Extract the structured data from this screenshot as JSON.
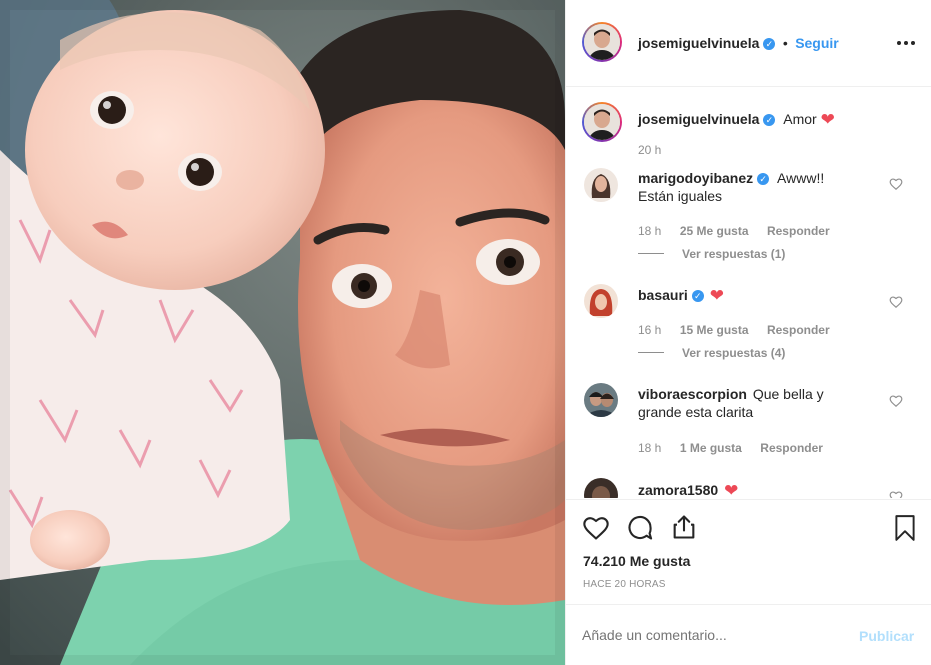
{
  "post": {
    "author": "josemiguelvinuela",
    "separator": "•",
    "follow_label": "Seguir",
    "more_icon": "more-horizontal-icon",
    "caption_text": "Amor",
    "caption_time": "20 h",
    "likes_text": "74.210 Me gusta",
    "posted_ago": "HACE 20 HORAS",
    "comment_placeholder": "Añade un comentario...",
    "publish_label": "Publicar"
  },
  "comments": [
    {
      "user": "marigodoyibanez",
      "verified": true,
      "text_line1": "Awww!!",
      "text_line2": "Están iguales",
      "time": "18 h",
      "likes": "25 Me gusta",
      "reply": "Responder",
      "view_replies": "Ver respuestas (1)"
    },
    {
      "user": "basauri",
      "verified": true,
      "time": "16 h",
      "likes": "15 Me gusta",
      "reply": "Responder",
      "view_replies": "Ver respuestas (4)"
    },
    {
      "user": "viboraescorpion",
      "text_line1": "Que bella y",
      "text_line2": "grande esta clarita",
      "time": "18 h",
      "likes": "1 Me gusta",
      "reply": "Responder"
    },
    {
      "user": "zamora1580"
    }
  ],
  "icons": {
    "like": "heart-outline-icon",
    "comment": "comment-bubble-icon",
    "share": "share-icon",
    "save": "bookmark-icon",
    "verified": "verified-badge-icon"
  },
  "colors": {
    "link_blue": "#3897f0",
    "publish_disabled": "#b2dffc",
    "heart_red": "#ed4956",
    "muted": "#8e8e8e"
  }
}
